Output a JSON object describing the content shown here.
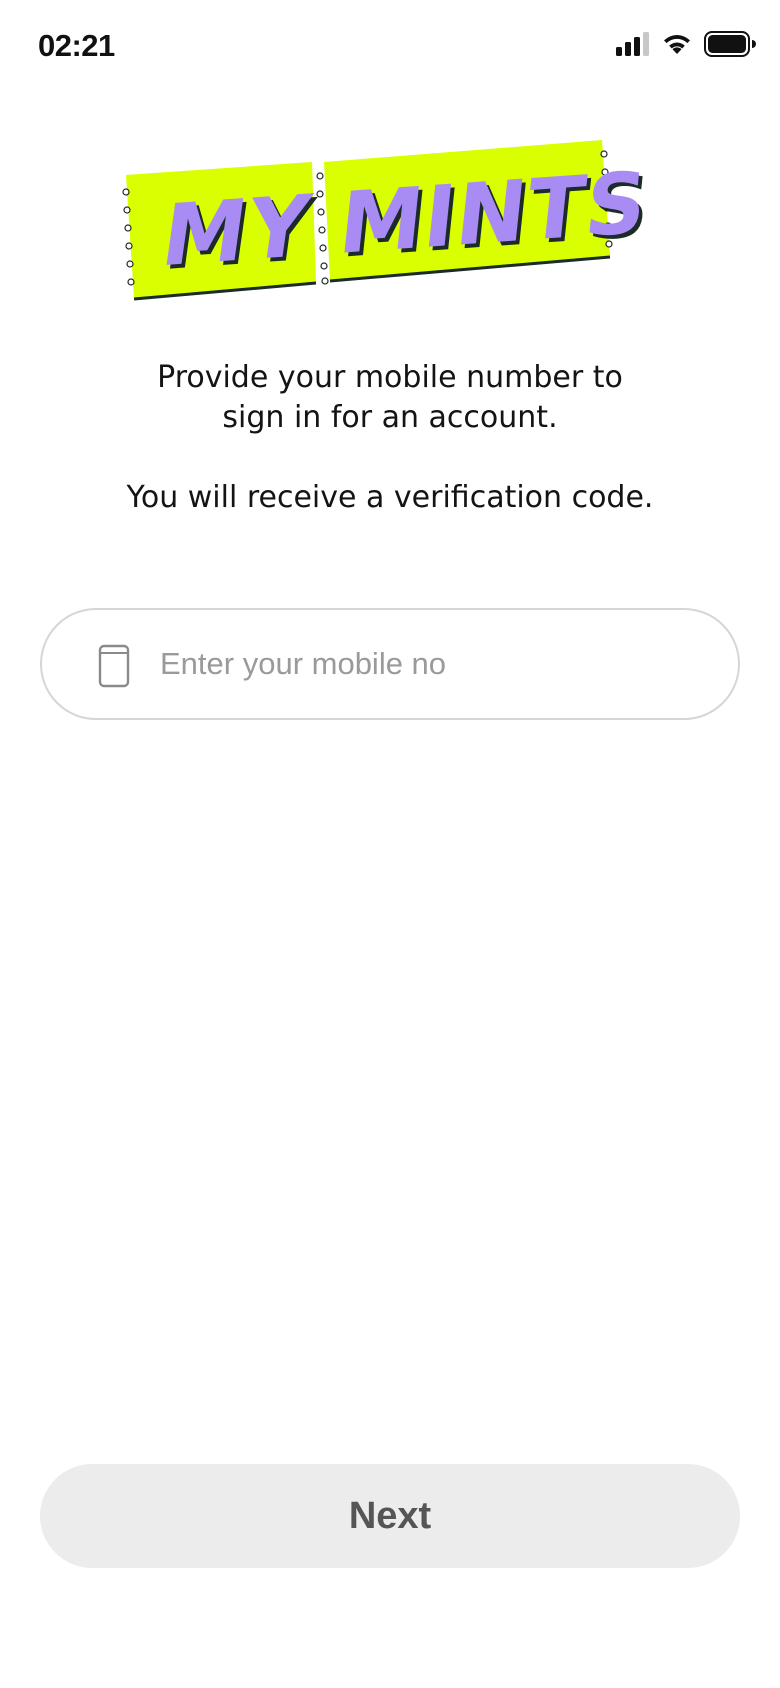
{
  "status_bar": {
    "time": "02:21",
    "icons": [
      "cellular-signal-icon",
      "wifi-icon",
      "battery-icon"
    ]
  },
  "logo": {
    "text": "MY MINTS",
    "colors": {
      "ticket": "#d9ff00",
      "letters": "#a98cf3",
      "outline": "#1b2b28"
    }
  },
  "intro": {
    "line1": "Provide your mobile number to",
    "line2": "sign in for an account.",
    "line3": "You will receive a verification code."
  },
  "phone_field": {
    "icon": "mobile-phone-icon",
    "value": "",
    "placeholder": "Enter your mobile no"
  },
  "next_button": {
    "label": "Next"
  },
  "colors": {
    "input_border": "#d6d6d6",
    "placeholder": "#9a9a9a",
    "button_bg": "#ececec",
    "button_text": "#555555"
  }
}
